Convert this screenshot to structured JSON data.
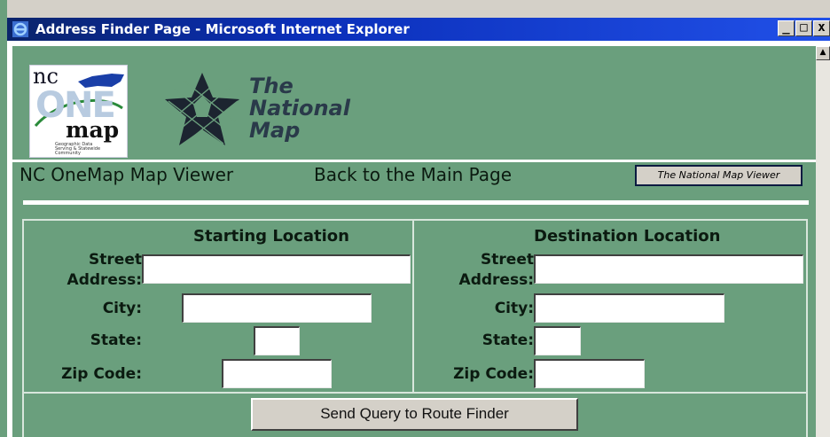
{
  "window": {
    "title": "Address Finder Page - Microsoft Internet Explorer",
    "controls": {
      "minimize": "_",
      "maximize": "□",
      "close": "x"
    }
  },
  "logos": {
    "nconemap": {
      "nc": "nc",
      "one": "ONE",
      "map": "map",
      "tagline": "Geographic Data Serving & Statewide Community"
    },
    "national_map": {
      "line1": "The",
      "line2": "National",
      "line3": "Map"
    }
  },
  "nav": {
    "nc_onemap_viewer": "NC OneMap Map Viewer",
    "back_to_main": "Back to the Main Page",
    "tnm_viewer_button": "The National Map Viewer"
  },
  "form": {
    "starting": {
      "heading": "Starting Location",
      "street_label_1": "Street",
      "street_label_2": "Address:",
      "city_label": "City:",
      "state_label": "State:",
      "zip_label": "Zip Code:",
      "street_value": "",
      "city_value": "",
      "state_value": "",
      "zip_value": ""
    },
    "destination": {
      "heading": "Destination Location",
      "street_label_1": "Street",
      "street_label_2": "Address:",
      "city_label": "City:",
      "state_label": "State:",
      "zip_label": "Zip Code:",
      "street_value": "",
      "city_value": "",
      "state_value": "",
      "zip_value": ""
    },
    "submit_label": "Send Query to Route Finder"
  },
  "colors": {
    "page_bg": "#6a9f7d",
    "title_bar": "#0a246a",
    "text": "#0b1a10"
  }
}
